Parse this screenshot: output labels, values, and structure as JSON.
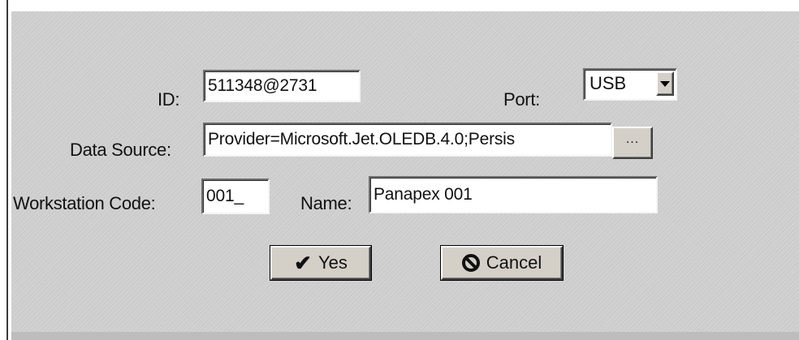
{
  "form": {
    "id_label": "ID:",
    "id_value": "511348@2731",
    "port_label": "Port:",
    "port_value": "USB",
    "datasource_label": "Data Source:",
    "datasource_value": "Provider=Microsoft.Jet.OLEDB.4.0;Persis",
    "browse_label": "...",
    "workstation_label": "Workstation Code:",
    "workstation_value": "001_",
    "name_label": "Name:",
    "name_value": "Panapex 001"
  },
  "buttons": {
    "yes_label": "Yes",
    "yes_icon": "checkmark-icon",
    "cancel_label": "Cancel",
    "cancel_icon": "prohibited-icon"
  },
  "colors": {
    "dialog_bg": "#cfcfcf",
    "field_bg": "#ffffff"
  }
}
